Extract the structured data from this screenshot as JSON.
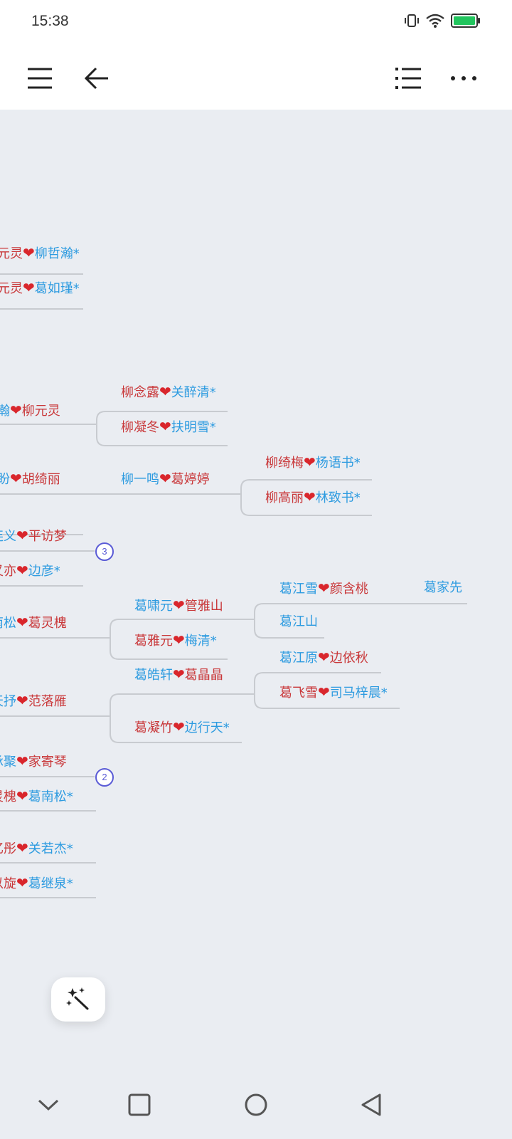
{
  "status_bar": {
    "time": "15:38",
    "icons": [
      "vibrate-icon",
      "wifi-icon",
      "battery-icon"
    ],
    "battery_color": "#22c55e"
  },
  "toolbar": {
    "left_icons": [
      "menu-icon",
      "back-arrow-icon"
    ],
    "right_icons": [
      "outline-list-icon",
      "more-options-icon"
    ]
  },
  "canvas": {
    "background": "#eaedf2",
    "heart_color": "#d9262c",
    "red_text_color": "#c9383a",
    "blue_text_color": "#2d9be0",
    "nodes": {
      "n1": {
        "a": "元灵",
        "b": "柳哲瀚*"
      },
      "n2": {
        "a": "元灵",
        "b": "葛如瑾*"
      },
      "n3": {
        "a": "哲瀚",
        "b": "柳元灵"
      },
      "n4": {
        "a": "柳念露",
        "b": "关醉清*"
      },
      "n5": {
        "a": "柳凝冬",
        "b": "扶明雪*"
      },
      "n6": {
        "a": "哲盼",
        "b": "胡绮丽"
      },
      "n7": {
        "a": "柳一鸣",
        "b": "葛婷婷"
      },
      "n8": {
        "a": "柳绮梅",
        "b": "杨语书*"
      },
      "n9": {
        "a": "柳高丽",
        "b": "林致书*"
      },
      "n10": {
        "a": "葛连义",
        "b": "平访梦"
      },
      "n11": {
        "a": "葛又亦",
        "b": "边彦*"
      },
      "n12": {
        "a": "葛江雪",
        "b": "颜含桃"
      },
      "n13": {
        "a": "葛家先"
      },
      "n14": {
        "a": "葛南松",
        "b": "葛灵槐"
      },
      "n15": {
        "a": "葛啸元",
        "b": "管雅山"
      },
      "n16": {
        "a": "葛江山"
      },
      "n17": {
        "a": "葛雅元",
        "b": "梅清*"
      },
      "n18": {
        "a": "葛江原",
        "b": "边依秋"
      },
      "n19": {
        "a": "葛皓轩",
        "b": "葛晶晶"
      },
      "n20": {
        "a": "葛天抒",
        "b": "范落雁"
      },
      "n21": {
        "a": "葛飞雪",
        "b": "司马梓晨*"
      },
      "n22": {
        "a": "葛凝竹",
        "b": "边行天*"
      },
      "n23": {
        "a": "葛承聚",
        "b": "家寄琴"
      },
      "n24": {
        "a": "葛灵槐",
        "b": "葛南松*"
      },
      "n25": {
        "a": "葛忆彤",
        "b": "关若杰*"
      },
      "n26": {
        "a": "葛以旋",
        "b": "葛继泉*"
      }
    },
    "badges": {
      "b1": "3",
      "b2": "2"
    }
  },
  "magic_button": {
    "icon": "magic-wand-icon"
  },
  "nav_bar": {
    "icons": [
      "collapse-chevron-icon",
      "recents-square-icon",
      "home-circle-icon",
      "back-triangle-icon"
    ]
  }
}
